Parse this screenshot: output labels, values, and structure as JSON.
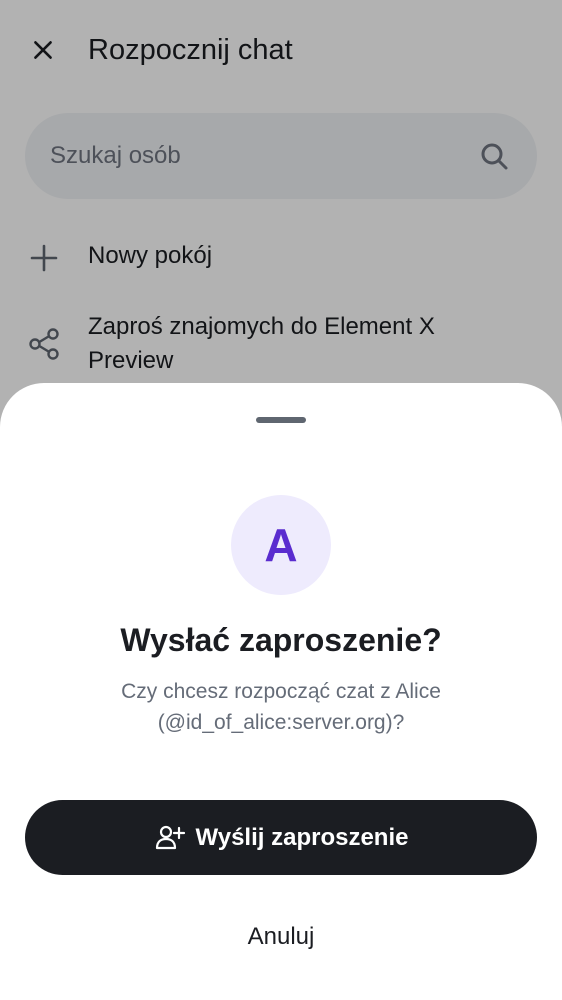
{
  "header": {
    "title": "Rozpocznij chat",
    "close_icon": "close-icon"
  },
  "search": {
    "placeholder": "Szukaj osób",
    "icon": "search-icon"
  },
  "menu": [
    {
      "label": "Nowy pokój",
      "icon": "plus-icon"
    },
    {
      "label": "Zaproś znajomych do Element X Preview",
      "icon": "share-icon"
    }
  ],
  "dialog": {
    "avatar_letter": "A",
    "title": "Wysłać zaproszenie?",
    "message": "Czy chcesz rozpocząć czat z Alice (@id_of_alice:server.org)?",
    "primary_button": {
      "label": "Wyślij zaproszenie",
      "icon": "add-person-icon"
    },
    "cancel_button": {
      "label": "Anuluj"
    }
  },
  "colors": {
    "accent": "#5a2ccf",
    "avatar_bg": "#eeebfd",
    "primary_button_bg": "#1b1d22",
    "text_primary": "#1b1d22",
    "text_secondary": "#656c78"
  }
}
